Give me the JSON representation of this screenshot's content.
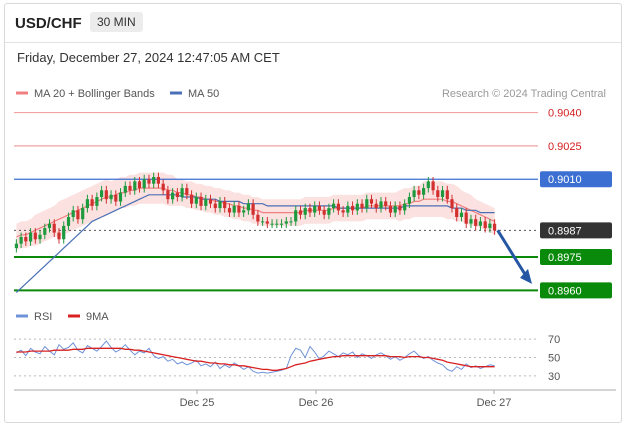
{
  "header": {
    "symbol": "USD/CHF",
    "timeframe": "30 MIN"
  },
  "datetime": "Friday, December 27, 2024 12:47:05 AM CET",
  "colors": {
    "resistance_line": "#f4a3a3",
    "pivot_line": "#3b6fd1",
    "support_line": "#0a8a0a",
    "last_price_tag": "#333333",
    "bollinger_fill": "#fbd9d9",
    "ma20": "#f08080",
    "ma50": "#4a6fb5",
    "candle_up": "#1d9a3e",
    "candle_down": "#d22f2f",
    "rsi": "#6f93d8",
    "rsi_9ma": "#d92121",
    "arrow": "#2456a3"
  },
  "chart_data": [
    {
      "type": "candlestick",
      "legend": [
        {
          "name": "MA 20 + Bollinger Bands",
          "color": "#f08080"
        },
        {
          "name": "MA 50",
          "color": "#4a6fb5"
        }
      ],
      "legend_placement": "top-left",
      "watermark": "Research © 2024 Trading Central",
      "ylim": [
        0.8957,
        0.9047
      ],
      "x_ticks": [
        "Dec 25",
        "Dec 26",
        "Dec 27"
      ],
      "levels": [
        {
          "label": "0.9040",
          "value": 0.904,
          "kind": "resistance"
        },
        {
          "label": "0.9025",
          "value": 0.9025,
          "kind": "resistance"
        },
        {
          "label": "0.9010",
          "value": 0.901,
          "kind": "pivot"
        },
        {
          "label": "0.8987",
          "value": 0.8987,
          "kind": "last"
        },
        {
          "label": "0.8975",
          "value": 0.8975,
          "kind": "support"
        },
        {
          "label": "0.8960",
          "value": 0.896,
          "kind": "support"
        }
      ],
      "close": [
        0.8981,
        0.8984,
        0.8982,
        0.8986,
        0.8983,
        0.8985,
        0.8988,
        0.899,
        0.8986,
        0.8983,
        0.8989,
        0.8993,
        0.8996,
        0.8992,
        0.8997,
        0.9001,
        0.8998,
        0.9002,
        0.9005,
        0.9001,
        0.9003,
        0.9,
        0.9004,
        0.9007,
        0.9005,
        0.9009,
        0.9006,
        0.901,
        0.9008,
        0.9011,
        0.9008,
        0.9005,
        0.9001,
        0.9004,
        0.9002,
        0.9006,
        0.9003,
        0.8999,
        0.9002,
        0.8998,
        0.9001,
        0.8999,
        0.8997,
        0.9,
        0.8997,
        0.8995,
        0.8998,
        0.8995,
        0.8996,
        0.8999,
        0.8994,
        0.8991,
        0.8991,
        0.899,
        0.899,
        0.899,
        0.899,
        0.8991,
        0.8991,
        0.8996,
        0.8994,
        0.8997,
        0.8995,
        0.8998,
        0.8996,
        0.8994,
        0.8997,
        0.8999,
        0.8996,
        0.8995,
        0.8998,
        0.8996,
        0.8999,
        0.8997,
        0.9001,
        0.8999,
        0.8997,
        0.9,
        0.8998,
        0.8995,
        0.8998,
        0.8996,
        0.8999,
        0.9002,
        0.9005,
        0.9003,
        0.9006,
        0.9009,
        0.9005,
        0.9002,
        0.9005,
        0.9001,
        0.8997,
        0.8993,
        0.8995,
        0.899,
        0.8992,
        0.8989,
        0.8991,
        0.8988,
        0.899,
        0.8987
      ],
      "ma20": [
        0.8984,
        0.8985,
        0.8985,
        0.8986,
        0.8987,
        0.8988,
        0.8989,
        0.899,
        0.8991,
        0.8992,
        0.8993,
        0.8994,
        0.8995,
        0.8996,
        0.8997,
        0.8998,
        0.8999,
        0.9,
        0.9001,
        0.9002,
        0.9002,
        0.9003,
        0.9004,
        0.9004,
        0.9005,
        0.9005,
        0.9006,
        0.9006,
        0.9006,
        0.9006,
        0.9006,
        0.9006,
        0.9005,
        0.9005,
        0.9004,
        0.9004,
        0.9003,
        0.9003,
        0.9002,
        0.9002,
        0.9001,
        0.9001,
        0.9,
        0.9,
        0.8999,
        0.8999,
        0.8998,
        0.8998,
        0.8997,
        0.8997,
        0.8996,
        0.8996,
        0.8995,
        0.8995,
        0.8995,
        0.8995,
        0.8995,
        0.8995,
        0.8995,
        0.8995,
        0.8995,
        0.8996,
        0.8996,
        0.8996,
        0.8996,
        0.8996,
        0.8996,
        0.8997,
        0.8997,
        0.8997,
        0.8997,
        0.8997,
        0.8997,
        0.8997,
        0.8998,
        0.8998,
        0.8998,
        0.8998,
        0.8998,
        0.8998,
        0.8998,
        0.8998,
        0.8999,
        0.8999,
        0.9,
        0.9,
        0.9001,
        0.9001,
        0.9001,
        0.9001,
        0.9001,
        0.9,
        0.9,
        0.8999,
        0.8998,
        0.8997,
        0.8996,
        0.8995,
        0.8994,
        0.8993,
        0.8992,
        0.8991
      ],
      "ma50": [
        0.8959,
        0.8961,
        0.8963,
        0.8965,
        0.8967,
        0.8969,
        0.8971,
        0.8973,
        0.8975,
        0.8977,
        0.8979,
        0.8981,
        0.8983,
        0.8985,
        0.8987,
        0.8989,
        0.8991,
        0.8992,
        0.8993,
        0.8994,
        0.8995,
        0.8996,
        0.8997,
        0.8998,
        0.8999,
        0.9,
        0.9001,
        0.9002,
        0.9003,
        0.9003,
        0.9003,
        0.9003,
        0.9003,
        0.9003,
        0.9003,
        0.9002,
        0.9002,
        0.9002,
        0.9002,
        0.9001,
        0.9001,
        0.9001,
        0.9001,
        0.9,
        0.9,
        0.9,
        0.9,
        0.9,
        0.8999,
        0.8999,
        0.8999,
        0.8999,
        0.8999,
        0.8998,
        0.8998,
        0.8998,
        0.8998,
        0.8998,
        0.8998,
        0.8998,
        0.8998,
        0.8998,
        0.8998,
        0.8998,
        0.8998,
        0.8998,
        0.8998,
        0.8998,
        0.8997,
        0.8997,
        0.8997,
        0.8997,
        0.8997,
        0.8997,
        0.8997,
        0.8997,
        0.8997,
        0.8997,
        0.8997,
        0.8997,
        0.8997,
        0.8997,
        0.8998,
        0.8998,
        0.8998,
        0.8998,
        0.8998,
        0.8998,
        0.8998,
        0.8998,
        0.8998,
        0.8998,
        0.8997,
        0.8997,
        0.8997,
        0.8996,
        0.8996,
        0.8996,
        0.8995,
        0.8995,
        0.8995,
        0.8995
      ],
      "bb_width": [
        0.0006,
        0.0006,
        0.0006,
        0.0006,
        0.0007,
        0.0007,
        0.0007,
        0.0007,
        0.0007,
        0.0008,
        0.0008,
        0.0008,
        0.0008,
        0.0008,
        0.0008,
        0.0008,
        0.0008,
        0.0008,
        0.0008,
        0.0008,
        0.0007,
        0.0007,
        0.0007,
        0.0007,
        0.0007,
        0.0007,
        0.0007,
        0.0007,
        0.0007,
        0.0007,
        0.0007,
        0.0007,
        0.0007,
        0.0007,
        0.0006,
        0.0006,
        0.0006,
        0.0006,
        0.0006,
        0.0006,
        0.0006,
        0.0006,
        0.0006,
        0.0006,
        0.0006,
        0.0006,
        0.0006,
        0.0006,
        0.0006,
        0.0006,
        0.0006,
        0.0006,
        0.0006,
        0.0006,
        0.0006,
        0.0006,
        0.0006,
        0.0006,
        0.0006,
        0.0006,
        0.0006,
        0.0006,
        0.0006,
        0.0006,
        0.0006,
        0.0006,
        0.0006,
        0.0006,
        0.0006,
        0.0006,
        0.0006,
        0.0006,
        0.0006,
        0.0006,
        0.0006,
        0.0006,
        0.0006,
        0.0006,
        0.0006,
        0.0006,
        0.0006,
        0.0007,
        0.0007,
        0.0007,
        0.0007,
        0.0007,
        0.0008,
        0.0008,
        0.0008,
        0.0008,
        0.0008,
        0.0008,
        0.0008,
        0.0008,
        0.0007,
        0.0007,
        0.0007,
        0.0006,
        0.0006,
        0.0006,
        0.0006,
        0.0006
      ],
      "forecast_arrow": {
        "from": 0.8987,
        "to": 0.8962
      }
    },
    {
      "type": "line",
      "legend": [
        {
          "name": "RSI",
          "color": "#6f93d8"
        },
        {
          "name": "9MA",
          "color": "#d92121"
        }
      ],
      "ylim": [
        20,
        80
      ],
      "y_ticks": [
        "70",
        "50",
        "30"
      ],
      "series": [
        {
          "name": "RSI",
          "values": [
            55,
            58,
            52,
            60,
            56,
            54,
            62,
            57,
            53,
            64,
            59,
            61,
            66,
            58,
            55,
            63,
            60,
            57,
            62,
            68,
            61,
            56,
            59,
            64,
            58,
            53,
            57,
            55,
            60,
            52,
            49,
            51,
            46,
            48,
            43,
            45,
            42,
            44,
            47,
            41,
            43,
            40,
            45,
            38,
            42,
            39,
            44,
            41,
            37,
            40,
            35,
            33,
            34,
            33,
            34,
            35,
            36,
            38,
            52,
            60,
            58,
            50,
            62,
            56,
            48,
            52,
            57,
            54,
            51,
            55,
            53,
            56,
            50,
            54,
            52,
            49,
            53,
            55,
            52,
            48,
            51,
            47,
            50,
            54,
            57,
            52,
            49,
            51,
            47,
            44,
            42,
            37,
            35,
            40,
            37,
            43,
            39,
            41,
            38,
            40,
            42,
            41
          ]
        },
        {
          "name": "9MA",
          "values": [
            56,
            56,
            56,
            57,
            57,
            57,
            57,
            57,
            58,
            58,
            58,
            58,
            59,
            59,
            59,
            60,
            60,
            60,
            60,
            60,
            60,
            60,
            60,
            59,
            59,
            58,
            58,
            57,
            56,
            55,
            54,
            53,
            52,
            51,
            50,
            49,
            48,
            47,
            46,
            46,
            45,
            44,
            44,
            43,
            43,
            42,
            42,
            41,
            41,
            40,
            39,
            38,
            37,
            37,
            36,
            36,
            37,
            38,
            40,
            42,
            43,
            44,
            46,
            47,
            48,
            49,
            50,
            51,
            51,
            52,
            52,
            52,
            52,
            52,
            52,
            52,
            52,
            52,
            52,
            51,
            51,
            51,
            50,
            51,
            51,
            51,
            50,
            50,
            49,
            48,
            47,
            45,
            44,
            43,
            42,
            41,
            40,
            40,
            40,
            40,
            40,
            40
          ]
        }
      ]
    }
  ]
}
